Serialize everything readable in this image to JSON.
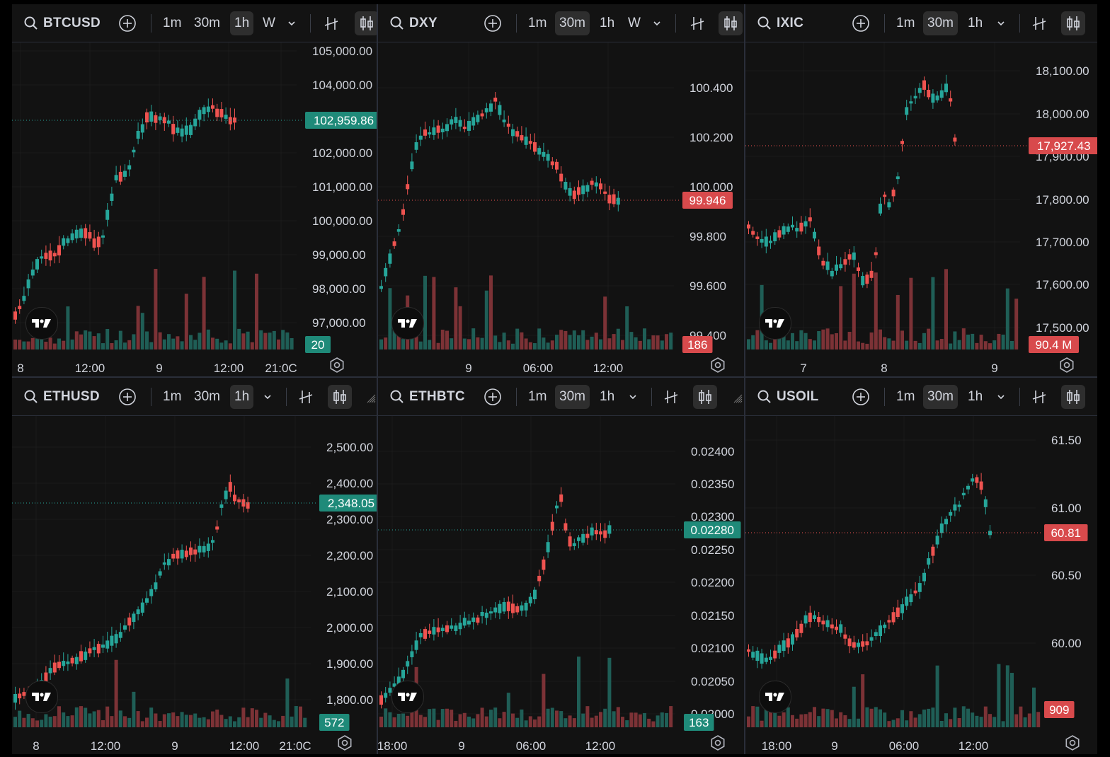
{
  "timeframes_short": [
    "1m",
    "30m",
    "1h"
  ],
  "timeframe_week": "W",
  "colors": {
    "up": "#26a69a",
    "down": "#ef5350",
    "up_label": "#1f8a79",
    "down_label": "#d84a4c",
    "bg": "#121212",
    "text": "#d1d4dc",
    "muted": "#9598a1"
  },
  "icons": {
    "search": "search-icon",
    "add": "plus-circle-icon",
    "indicators": "indicators-icon",
    "candles": "candlestick-icon",
    "dropdown": "chevron-down-icon",
    "settings": "gear-icon",
    "logo": "tradingview-logo",
    "resize": "resize-handle-icon"
  },
  "panels": [
    {
      "symbol": "BTCUSD",
      "active_tf": "1h",
      "has_w": true,
      "price_label": "102,959.86",
      "price_color": "up",
      "volume_label": "20",
      "volume_color": "up",
      "y_ticks": [
        "105,000.00",
        "104,000.00",
        "102,000.00",
        "101,000.00",
        "100,000.00",
        "99,000.00",
        "98,000.00",
        "97,000.00"
      ],
      "x_ticks": [
        "8",
        "12:00",
        "9",
        "12:00",
        "21:0C"
      ]
    },
    {
      "symbol": "DXY",
      "active_tf": "30m",
      "has_w": true,
      "price_label": "99.946",
      "price_color": "down",
      "volume_label": "186",
      "volume_color": "down",
      "y_ticks": [
        "100.400",
        "100.200",
        "100.000",
        "99.800",
        "99.600",
        "99.400"
      ],
      "x_ticks": [
        "9",
        "06:00",
        "12:00"
      ]
    },
    {
      "symbol": "IXIC",
      "active_tf": "30m",
      "has_w": false,
      "price_label": "17,927.43",
      "price_color": "down",
      "volume_label": "90.4 M",
      "volume_color": "down",
      "y_ticks": [
        "18,100.00",
        "18,000.00",
        "17,900.00",
        "17,800.00",
        "17,700.00",
        "17,600.00",
        "17,500.00"
      ],
      "x_ticks": [
        "7",
        "8",
        "9"
      ]
    },
    {
      "symbol": "ETHUSD",
      "active_tf": "1h",
      "has_w": false,
      "price_label": "2,348.05",
      "price_color": "up",
      "volume_label": "572",
      "volume_color": "up",
      "y_ticks": [
        "2,500.00",
        "2,400.00",
        "2,300.00",
        "2,200.00",
        "2,100.00",
        "2,000.00",
        "1,900.00",
        "1,800.00"
      ],
      "x_ticks": [
        "8",
        "12:00",
        "9",
        "12:00",
        "21:0C"
      ]
    },
    {
      "symbol": "ETHBTC",
      "active_tf": "30m",
      "has_w": false,
      "price_label": "0.02280",
      "price_color": "up",
      "volume_label": "163",
      "volume_color": "up",
      "y_ticks": [
        "0.02400",
        "0.02350",
        "0.02300",
        "0.02250",
        "0.02200",
        "0.02150",
        "0.02100",
        "0.02050",
        "0.02000"
      ],
      "x_ticks": [
        "18:00",
        "9",
        "06:00",
        "12:00"
      ]
    },
    {
      "symbol": "USOIL",
      "active_tf": "30m",
      "has_w": false,
      "price_label": "60.81",
      "price_color": "down",
      "volume_label": "909",
      "volume_color": "down",
      "y_ticks": [
        "61.50",
        "61.00",
        "60.50",
        "60.00"
      ],
      "x_ticks": [
        "18:00",
        "9",
        "06:00",
        "12:00"
      ]
    }
  ]
}
